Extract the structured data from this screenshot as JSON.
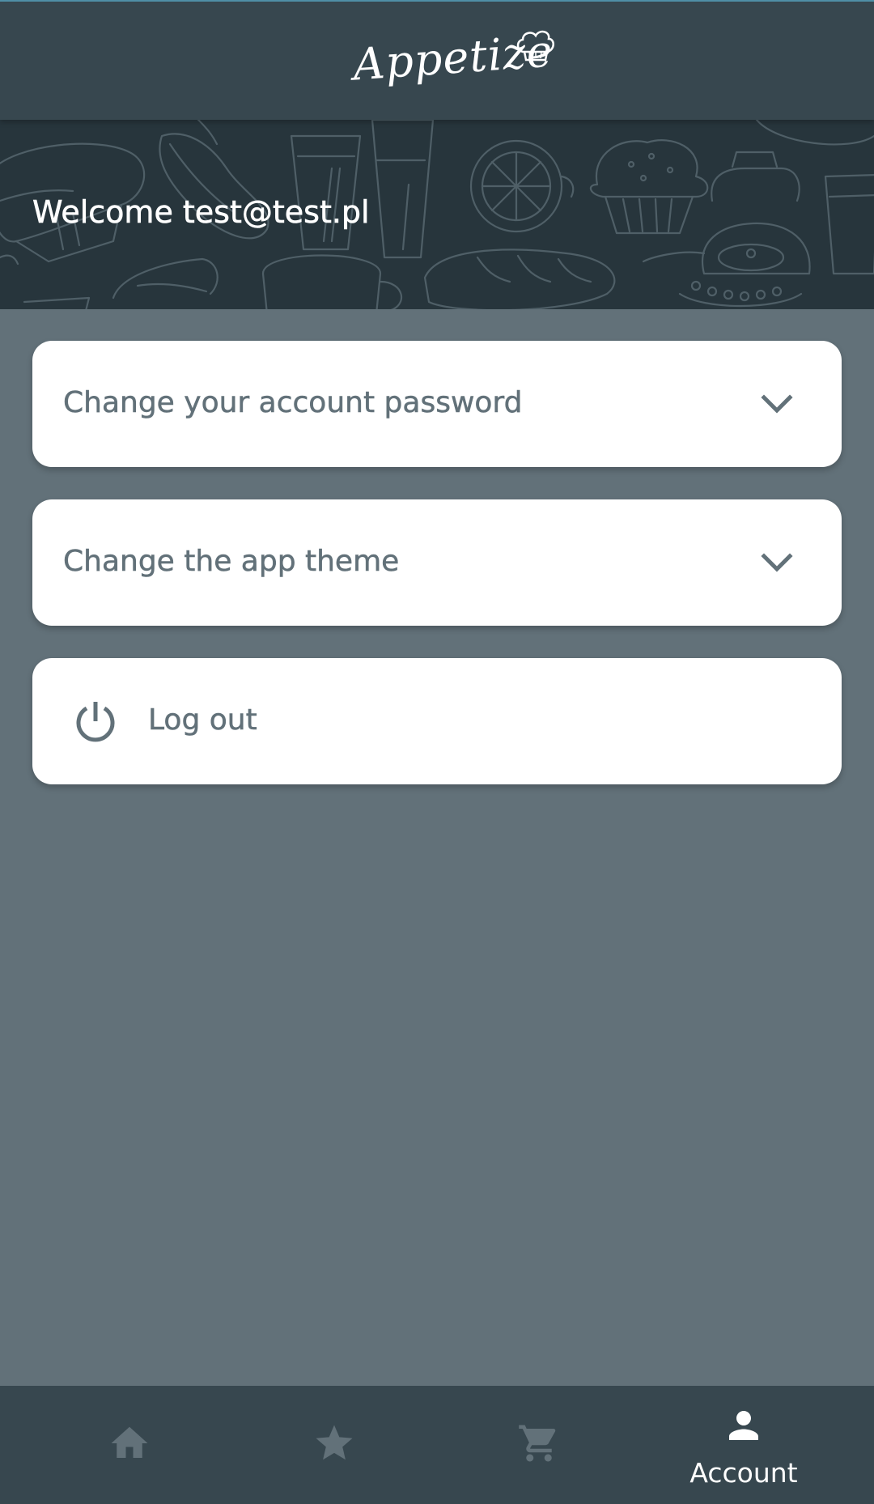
{
  "app": {
    "logo_text": "Appetize"
  },
  "hero": {
    "welcome_text": "Welcome test@test.pl"
  },
  "settings": {
    "items": [
      {
        "label": "Change your account password",
        "icon": "chevron-down-icon"
      },
      {
        "label": "Change the app theme",
        "icon": "chevron-down-icon"
      },
      {
        "label": "Log out",
        "icon": "power-icon"
      }
    ]
  },
  "bottom_nav": {
    "items": [
      {
        "icon": "home-icon",
        "label": "",
        "active": false
      },
      {
        "icon": "star-icon",
        "label": "",
        "active": false
      },
      {
        "icon": "cart-icon",
        "label": "",
        "active": false
      },
      {
        "icon": "account-icon",
        "label": "Account",
        "active": true
      }
    ]
  },
  "colors": {
    "app_bar": "#37474f",
    "background": "#627179",
    "hero": "#27353c",
    "card": "#ffffff",
    "card_text": "#627179",
    "nav_inactive_icon": "#627179",
    "nav_active": "#ffffff"
  }
}
